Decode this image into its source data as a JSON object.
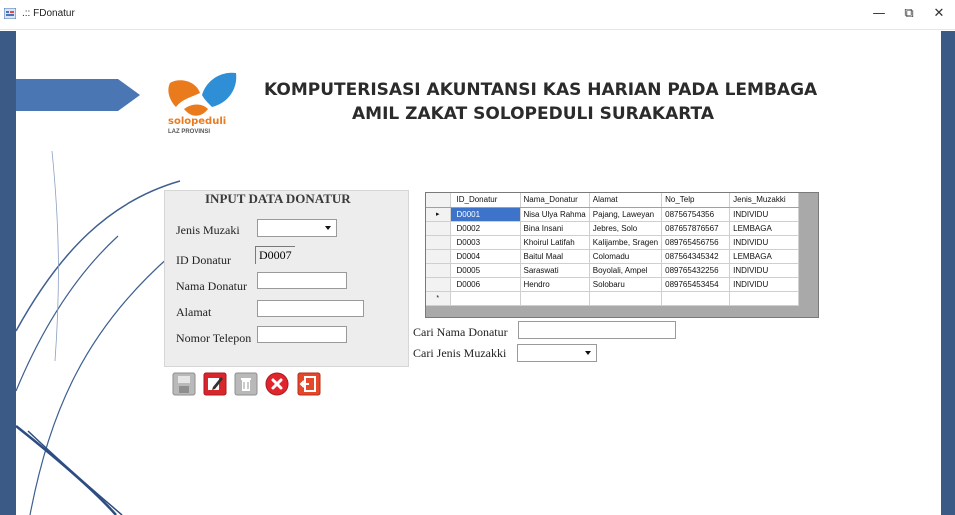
{
  "window": {
    "title": ".:: FDonatur",
    "minimize_glyph": "—",
    "maximize_glyph": "⧉",
    "close_glyph": "✕"
  },
  "logo": {
    "brand": "solopeduli",
    "subtitle": "LAZ PROVINSI"
  },
  "header": {
    "line1": "KOMPUTERISASI AKUNTANSI KAS HARIAN PADA LEMBAGA",
    "line2": "AMIL ZAKAT SOLOPEDULI SURAKARTA"
  },
  "input_panel": {
    "title": "INPUT DATA DONATUR",
    "jenis_muzaki_label": "Jenis Muzaki",
    "jenis_muzaki_value": "",
    "id_donatur_label": "ID Donatur",
    "id_donatur_value": "D0007",
    "nama_donatur_label": "Nama Donatur",
    "nama_donatur_value": "",
    "alamat_label": "Alamat",
    "alamat_value": "",
    "nomor_telepon_label": "Nomor Telepon",
    "nomor_telepon_value": ""
  },
  "toolbar": {
    "buttons": [
      "save-icon",
      "edit-icon",
      "delete-icon",
      "cancel-icon",
      "exit-icon"
    ]
  },
  "grid": {
    "columns": [
      "ID_Donatur",
      "Nama_Donatur",
      "Alamat",
      "No_Telp",
      "Jenis_Muzakki"
    ],
    "rows": [
      [
        "D0001",
        "Nisa Ulya Rahma",
        "Pajang, Laweyan",
        "08756754356",
        "INDIVIDU"
      ],
      [
        "D0002",
        "Bina Insani",
        "Jebres, Solo",
        "087657876567",
        "LEMBAGA"
      ],
      [
        "D0003",
        "Khoirul Latifah",
        "Kalijambe, Sragen",
        "089765456756",
        "INDIVIDU"
      ],
      [
        "D0004",
        "Baitul Maal",
        "Colomadu",
        "087564345342",
        "LEMBAGA"
      ],
      [
        "D0005",
        "Saraswati",
        "Boyolali, Ampel",
        "089765432256",
        "INDIVIDU"
      ],
      [
        "D0006",
        "Hendro",
        "Solobaru",
        "089765453454",
        "INDIVIDU"
      ]
    ],
    "current_row_marker": "▸",
    "new_row_marker": "*"
  },
  "search": {
    "nama_label": "Cari Nama Donatur",
    "nama_value": "",
    "jenis_label": "Cari Jenis Muzakki",
    "jenis_value": ""
  },
  "colors": {
    "border_blue": "#3c5a86",
    "selection": "#3d73c9",
    "logo_orange": "#ea7b1d",
    "logo_blue": "#2e8fd6"
  }
}
